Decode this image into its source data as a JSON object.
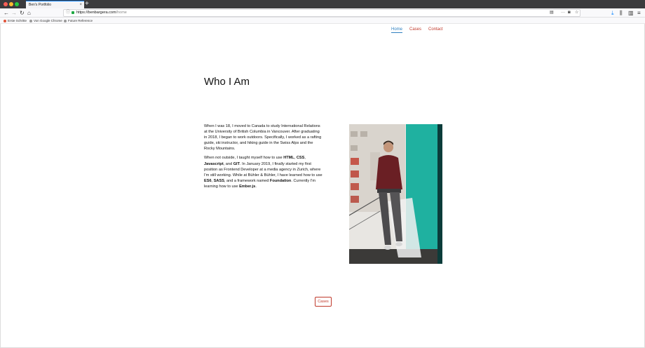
{
  "browser": {
    "tab_title": "Ben's Portfolio",
    "tab_close": "×",
    "new_tab": "+",
    "url_domain": "https://benbargera.com",
    "url_path": "/home",
    "bookmarks": [
      {
        "label": "Erste Schritte",
        "color": "#e0543a"
      },
      {
        "label": "Von Google Chrome",
        "color": "#888888"
      },
      {
        "label": "Future Reference",
        "color": "#888888"
      }
    ]
  },
  "nav": {
    "home": "Home",
    "cases": "Cases",
    "contact": "Contact"
  },
  "main": {
    "title": "Who I Am",
    "p1": "When I was 18, I moved to Canada to study International Relations at the University of British Columbia in Vancouver. After graduating in 2018, I began to work outdoors. Specifically, I worked as a rafting guide, ski instructor, and hiking guide in the Swiss Alps and the Rocky Mountains.",
    "p2": {
      "t1": "When not outside, I taught myself how to use ",
      "b1": "HTML",
      "t2": ", ",
      "b2": "CSS",
      "t3": ", ",
      "b3": "Javascript",
      "t4": ", and ",
      "b4": "GIT",
      "t5": ". In January 2019, I finally started my first position as Frontend Developer at a media agency in Zurich, where I'm still working. While at Bühler & Bühler, I have learned how to use ",
      "b5": "ES6",
      "t6": ", ",
      "b6": "SASS",
      "t7": ", and a framework named ",
      "b7": "Foundation",
      "t8": ". Currently I'm learning how to use ",
      "b8": "Ember.js",
      "t9": "."
    },
    "cases_button": "Cases"
  },
  "colors": {
    "accent_red": "#c0392b",
    "active_blue": "#2f80c0"
  }
}
